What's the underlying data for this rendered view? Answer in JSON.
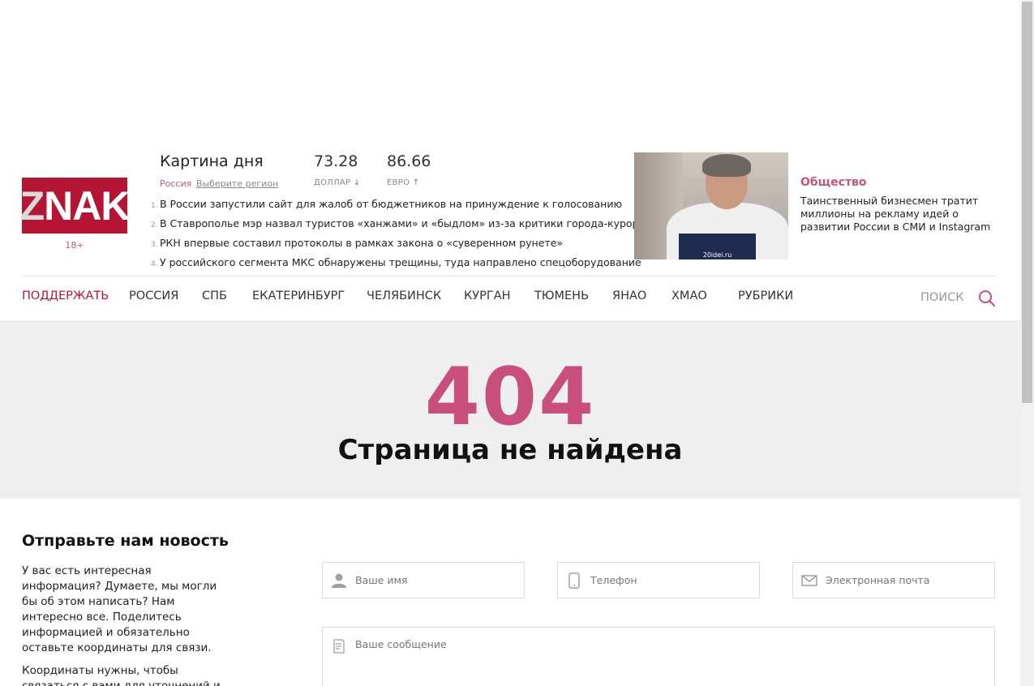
{
  "logo": {
    "text_z": "Z",
    "text_rest": "NAK",
    "age": "18+"
  },
  "kartina": {
    "title": "Картина дня",
    "region": "Россия",
    "region_select": "Выберите регион",
    "news": [
      {
        "num": "1.",
        "text": "В России запустили сайт для жалоб от бюджетников на принуждение к голосованию"
      },
      {
        "num": "2.",
        "text": "В Ставрополье мэр назвал туристов «ханжами» и «быдлом» из-за критики города-курорта"
      },
      {
        "num": "3.",
        "text": "РКН впервые составил протоколы в рамках закона о «суверенном рунете»"
      },
      {
        "num": "4.",
        "text": "У российского сегмента МКС обнаружены трещины, туда направлено спецоборудование"
      }
    ]
  },
  "rates": {
    "usd": {
      "value": "73.28",
      "label": "ДОЛЛАР",
      "arrow": "↓"
    },
    "eur": {
      "value": "86.66",
      "label": "ЕВРО",
      "arrow": "↑"
    }
  },
  "feature": {
    "category": "Общество",
    "text": "Таинственный бизнесмен тратит миллионы на рекламу идей о развитии России в СМИ и Instagram",
    "image_caption": "20idei.ru"
  },
  "nav": {
    "items": [
      "ПОДДЕРЖАТЬ",
      "РОССИЯ",
      "СПБ",
      "ЕКАТЕРИНБУРГ",
      "ЧЕЛЯБИНСК",
      "КУРГАН",
      "ТЮМЕНЬ",
      "ЯНАО",
      "ХМАО",
      "РУБРИКИ"
    ],
    "search_label": "ПОИСК"
  },
  "error": {
    "code": "404",
    "message": "Страница не найдена"
  },
  "form": {
    "title": "Отправьте нам новость",
    "desc": "У вас есть интересная информация? Думаете, мы могли бы об этом написать? Нам интересно все. Поделитесь информацией и обязательно оставьте координаты для связи.",
    "desc2": "Координаты нужны, чтобы связаться с вами для уточнений и",
    "name_placeholder": "Ваше имя",
    "phone_placeholder": "Телефон",
    "email_placeholder": "Электронная почта",
    "message_placeholder": "Ваше сообщение"
  },
  "colors": {
    "brand": "#b31532",
    "accent": "#c84f7b",
    "band": "#efefef"
  }
}
